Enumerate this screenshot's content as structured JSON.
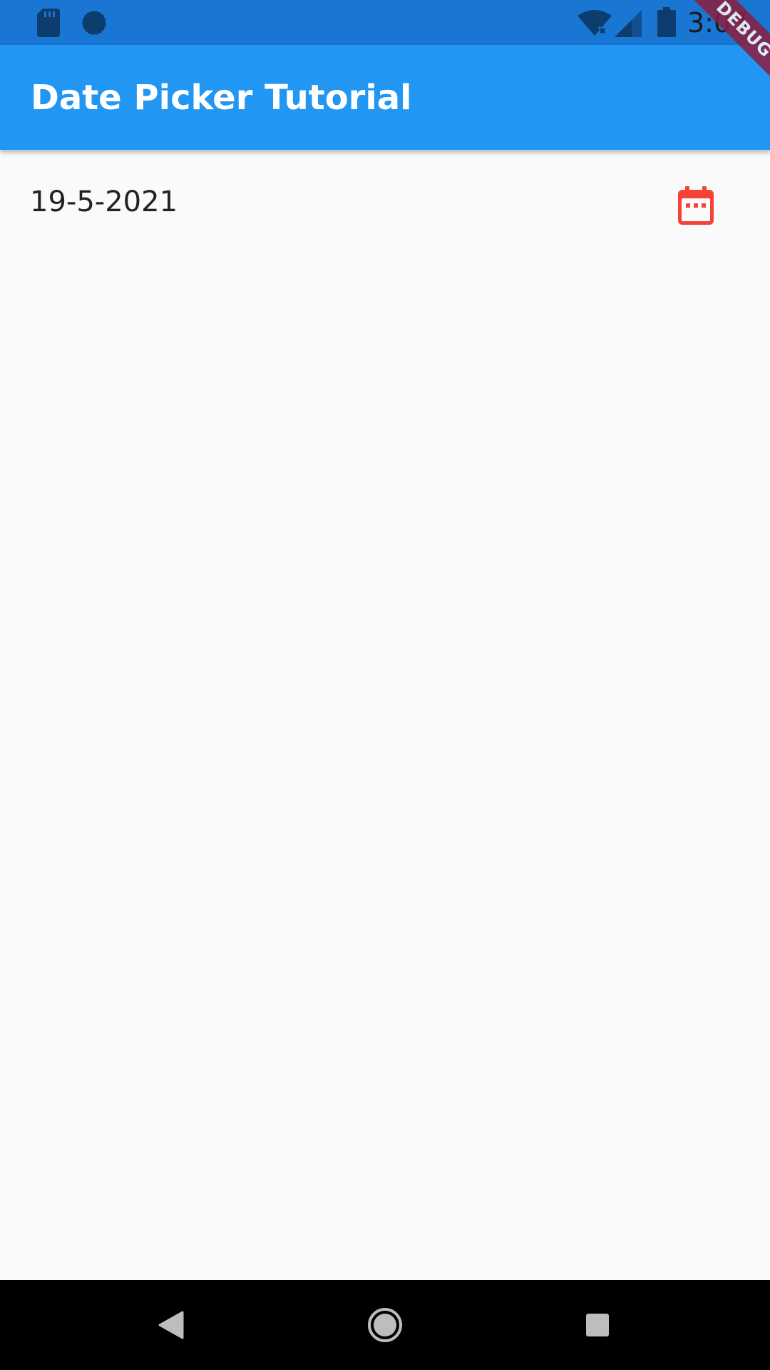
{
  "status_bar": {
    "time": "3:07",
    "color": "#1976d2",
    "icons": [
      "sd-card-icon",
      "sync-icon",
      "wifi-off-icon",
      "signal-icon",
      "battery-icon"
    ]
  },
  "app_bar": {
    "title": "Date Picker Tutorial",
    "color": "#2196f3"
  },
  "debug_banner": {
    "label": "DEBUG"
  },
  "content": {
    "selected_date": "19-5-2021",
    "calendar_icon": "calendar-icon",
    "calendar_color": "#f44336"
  },
  "nav_bar": {
    "buttons": [
      "back-icon",
      "home-icon",
      "recent-apps-icon"
    ]
  }
}
